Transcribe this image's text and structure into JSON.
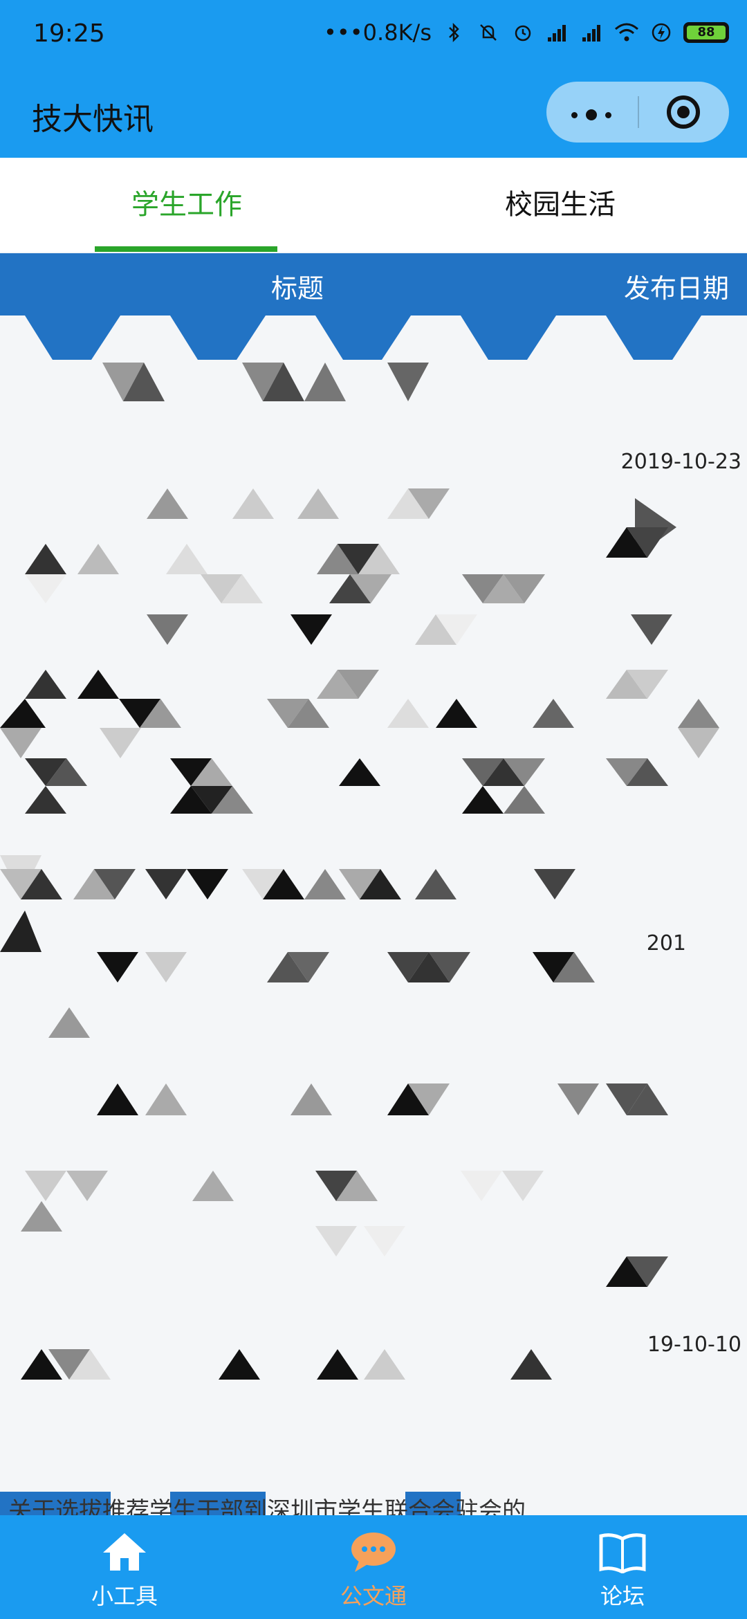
{
  "status_bar": {
    "time": "19:25",
    "speed": "0.8K/s",
    "battery": "88"
  },
  "header": {
    "title": "技大快讯"
  },
  "tabs": [
    {
      "label": "学生工作",
      "active": true
    },
    {
      "label": "校园生活",
      "active": false
    }
  ],
  "columns": {
    "title": "标题",
    "date": "发布日期"
  },
  "rows": [
    {
      "date": "2019-10-23"
    },
    {
      "date": "201"
    },
    {
      "date": "19-10-10",
      "title": "关于选拔推荐学生干部到深圳市学生联合会驻会的"
    }
  ],
  "bottom_nav": [
    {
      "label": "小工具",
      "icon": "home-icon",
      "active": false
    },
    {
      "label": "公文通",
      "icon": "chat-bubble-icon",
      "active": true,
      "active_color": "#f6a15a"
    },
    {
      "label": "论坛",
      "icon": "book-icon",
      "active": false
    }
  ],
  "colors": {
    "primary": "#1a9bf0",
    "column_header": "#2273c4",
    "tab_active": "#2aa52a"
  }
}
